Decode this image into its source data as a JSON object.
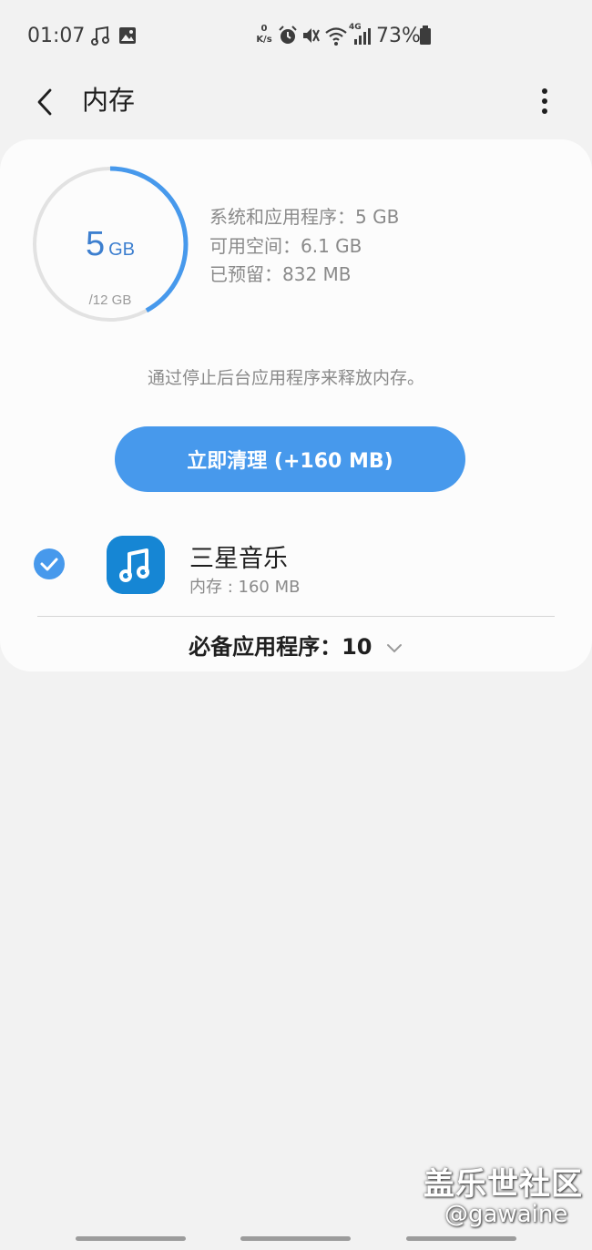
{
  "status_bar": {
    "time": "01:07",
    "net_speed_value": "0",
    "net_speed_unit": "K/s",
    "network": "4G",
    "battery": "73%",
    "icons": [
      "music-note-icon",
      "image-icon",
      "alarm-icon",
      "mute-icon",
      "wifi-icon",
      "signal-icon",
      "battery-icon"
    ]
  },
  "app_bar": {
    "title": "内存"
  },
  "memory": {
    "used_value": "5",
    "used_unit": "GB",
    "total": "/12 GB",
    "used_fraction": 0.42,
    "stats": [
      "系统和应用程序：5 GB",
      "可用空间：6.1 GB",
      "已预留：832 MB"
    ],
    "hint": "通过停止后台应用程序来释放内存。",
    "clean_button": "立即清理 (+160 MB)"
  },
  "apps": [
    {
      "name": "三星音乐",
      "memory": "内存 : 160 MB",
      "checked": true
    }
  ],
  "essential_apps": "必备应用程序：10",
  "watermark": {
    "title": "盖乐世社区",
    "user": "@gawaine"
  },
  "colors": {
    "accent": "#4799ec",
    "gauge_value": "#3d7fcf",
    "app_icon": "#1686d4",
    "background": "#f2f2f2",
    "card": "#fcfcfc"
  }
}
